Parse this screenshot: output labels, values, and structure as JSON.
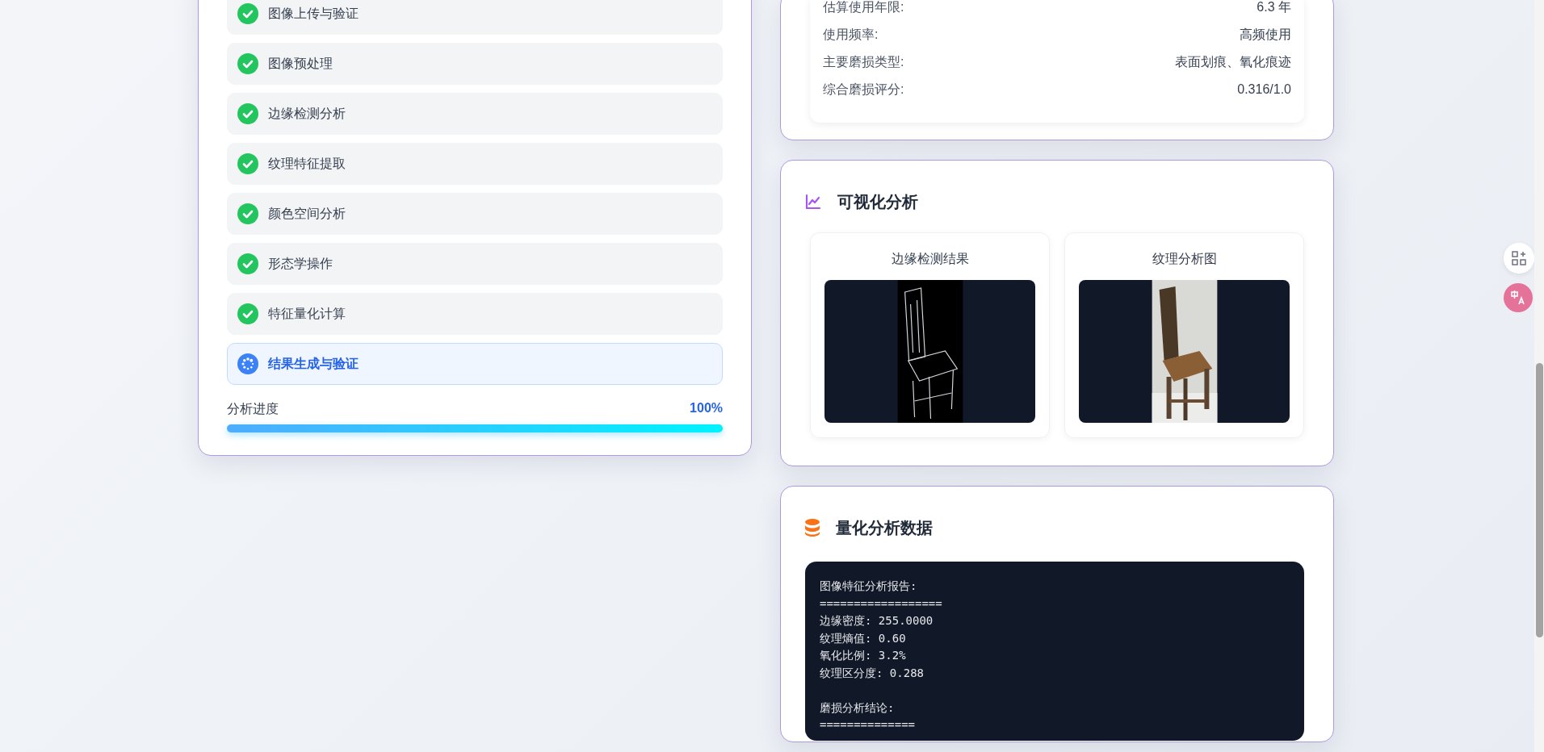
{
  "steps": [
    {
      "label": "图像上传与验证",
      "completed": true
    },
    {
      "label": "图像预处理",
      "completed": true
    },
    {
      "label": "边缘检测分析",
      "completed": true
    },
    {
      "label": "纹理特征提取",
      "completed": true
    },
    {
      "label": "颜色空间分析",
      "completed": true
    },
    {
      "label": "形态学操作",
      "completed": true
    },
    {
      "label": "特征量化计算",
      "completed": true
    },
    {
      "label": "结果生成与验证",
      "completed": false
    }
  ],
  "progress": {
    "label": "分析进度",
    "reading": "100%",
    "level": 1.0
  },
  "wear_summary": {
    "rows": [
      {
        "label": "估算使用年限:",
        "value": "6.3 年"
      },
      {
        "label": "使用频率:",
        "value": "高频使用"
      },
      {
        "label": "主要磨损类型:",
        "value": "表面划痕、氧化痕迹"
      },
      {
        "label": "综合磨损评分:",
        "value": "0.316/1.0"
      }
    ]
  },
  "visualization": {
    "title": "可视化分析",
    "images": [
      {
        "caption": "边缘检测结果",
        "kind": "edges"
      },
      {
        "caption": "纹理分析图"
      }
    ]
  },
  "quantitative": {
    "title": "量化分析数据",
    "sections": [
      {
        "heading": "图像特征分析报告:",
        "rule": "==================",
        "lines": [
          "边缘密度: 255.0000",
          "纹理熵值: 0.60",
          "氧化比例: 3.2%",
          "纹理区分度: 0.288"
        ]
      },
      {
        "heading": "磨损分析结论:",
        "rule": "=============="
      }
    ]
  }
}
